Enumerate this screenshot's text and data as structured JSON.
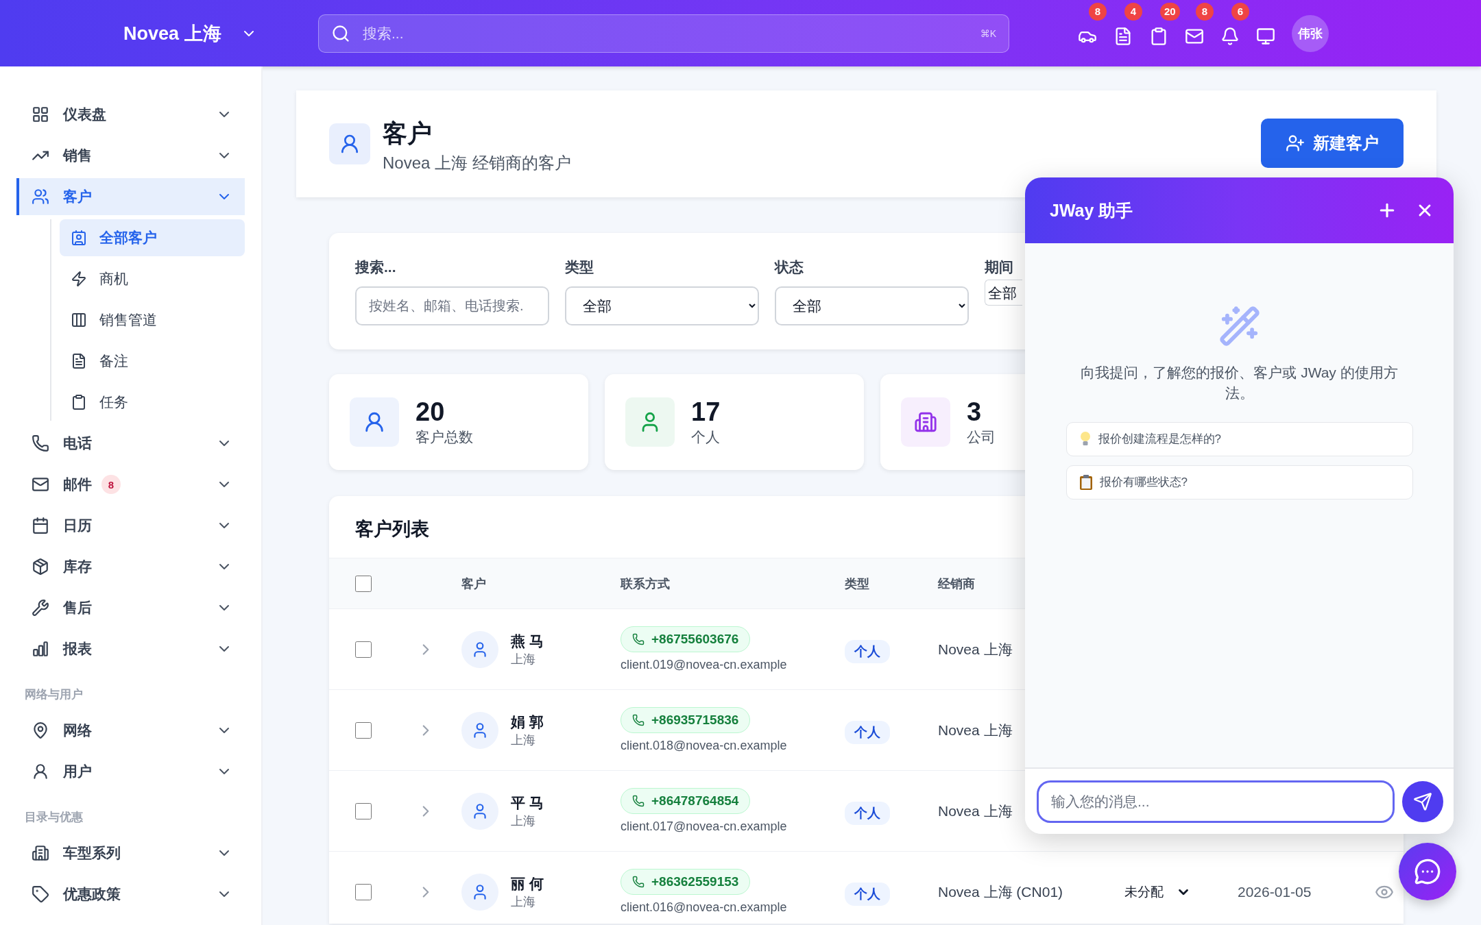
{
  "topbar": {
    "brand": "Novea 上海",
    "search": {
      "placeholder": "搜索...",
      "shortcut": "⌘K"
    },
    "icons": [
      {
        "kind": "car",
        "badge": "8"
      },
      {
        "kind": "document",
        "badge": "4"
      },
      {
        "kind": "clipboard",
        "badge": "20"
      },
      {
        "kind": "mail",
        "badge": "8"
      },
      {
        "kind": "bell",
        "badge": "6"
      },
      {
        "kind": "monitor"
      }
    ],
    "avatar": "伟张"
  },
  "sidebar": {
    "groups": [
      {
        "items": [
          {
            "label": "仪表盘",
            "selected": false,
            "expanded": false
          },
          {
            "label": "销售",
            "selected": false,
            "expanded": false
          },
          {
            "label": "客户",
            "selected": true,
            "expanded": true,
            "children": [
              {
                "label": "全部客户",
                "selected": true
              },
              {
                "label": "商机",
                "selected": false
              },
              {
                "label": "销售管道",
                "selected": false
              },
              {
                "label": "备注",
                "selected": false
              },
              {
                "label": "任务",
                "selected": false
              }
            ]
          },
          {
            "label": "电话",
            "selected": false,
            "expanded": false
          },
          {
            "label": "邮件",
            "selected": false,
            "expanded": false,
            "badge": "8"
          },
          {
            "label": "日历",
            "selected": false,
            "expanded": false
          },
          {
            "label": "库存",
            "selected": false,
            "expanded": false
          },
          {
            "label": "售后",
            "selected": false,
            "expanded": false
          },
          {
            "label": "报表",
            "selected": false,
            "expanded": false
          }
        ]
      },
      {
        "heading": "网络与用户",
        "items": [
          {
            "label": "网络",
            "selected": false,
            "expanded": false
          },
          {
            "label": "用户",
            "selected": false,
            "expanded": false
          }
        ]
      },
      {
        "heading": "目录与优惠",
        "items": [
          {
            "label": "车型系列",
            "selected": false,
            "expanded": false
          },
          {
            "label": "优惠政策",
            "selected": false,
            "expanded": false
          }
        ]
      }
    ]
  },
  "header": {
    "title": "客户",
    "subtitle": "Novea 上海 经销商的客户",
    "action": "新建客户"
  },
  "filters": [
    {
      "kind": "text",
      "label": "搜索...",
      "placeholder": "按姓名、邮箱、电话搜索."
    },
    {
      "kind": "select",
      "label": "类型",
      "value": "全部"
    },
    {
      "kind": "select",
      "label": "状态",
      "value": "全部"
    },
    {
      "kind": "select",
      "label": "期间",
      "value": "全部"
    }
  ],
  "stats": [
    {
      "value": "20",
      "label": "客户总数",
      "color": "#2563eb"
    },
    {
      "value": "17",
      "label": "个人",
      "color": "#16a34a"
    },
    {
      "value": "3",
      "label": "公司",
      "color": "#9333ea"
    }
  ],
  "table": {
    "title": "客户列表",
    "select_all": {
      "checked": false
    },
    "columns": [
      "客户",
      "联系方式",
      "类型",
      "经销商"
    ],
    "rows": [
      {
        "checked": false,
        "expanded": false,
        "name": "燕 马",
        "city": "上海",
        "phone": "+86755603676",
        "email": "client.019@novea-cn.example",
        "type": "个人",
        "dealer": "Novea 上海"
      },
      {
        "checked": false,
        "expanded": false,
        "name": "娟 郭",
        "city": "上海",
        "phone": "+86935715836",
        "email": "client.018@novea-cn.example",
        "type": "个人",
        "dealer": "Novea 上海"
      },
      {
        "checked": false,
        "expanded": false,
        "name": "平 马",
        "city": "上海",
        "phone": "+86478764854",
        "email": "client.017@novea-cn.example",
        "type": "个人",
        "dealer": "Novea 上海"
      },
      {
        "checked": false,
        "expanded": false,
        "name": "丽 何",
        "city": "上海",
        "phone": "+86362559153",
        "email": "client.016@novea-cn.example",
        "type": "个人",
        "dealer": "Novea 上海 (CN01)",
        "assignee": "未分配",
        "date": "2026-01-05"
      }
    ]
  },
  "assistant": {
    "title": "JWay 助手",
    "intro": "向我提问，了解您的报价、客户或 JWay 的使用方法。",
    "suggestions": [
      {
        "kind": "idea",
        "text": "报价创建流程是怎样的?"
      },
      {
        "kind": "list",
        "text": "报价有哪些状态?"
      }
    ],
    "input": {
      "placeholder": "输入您的消息..."
    }
  }
}
